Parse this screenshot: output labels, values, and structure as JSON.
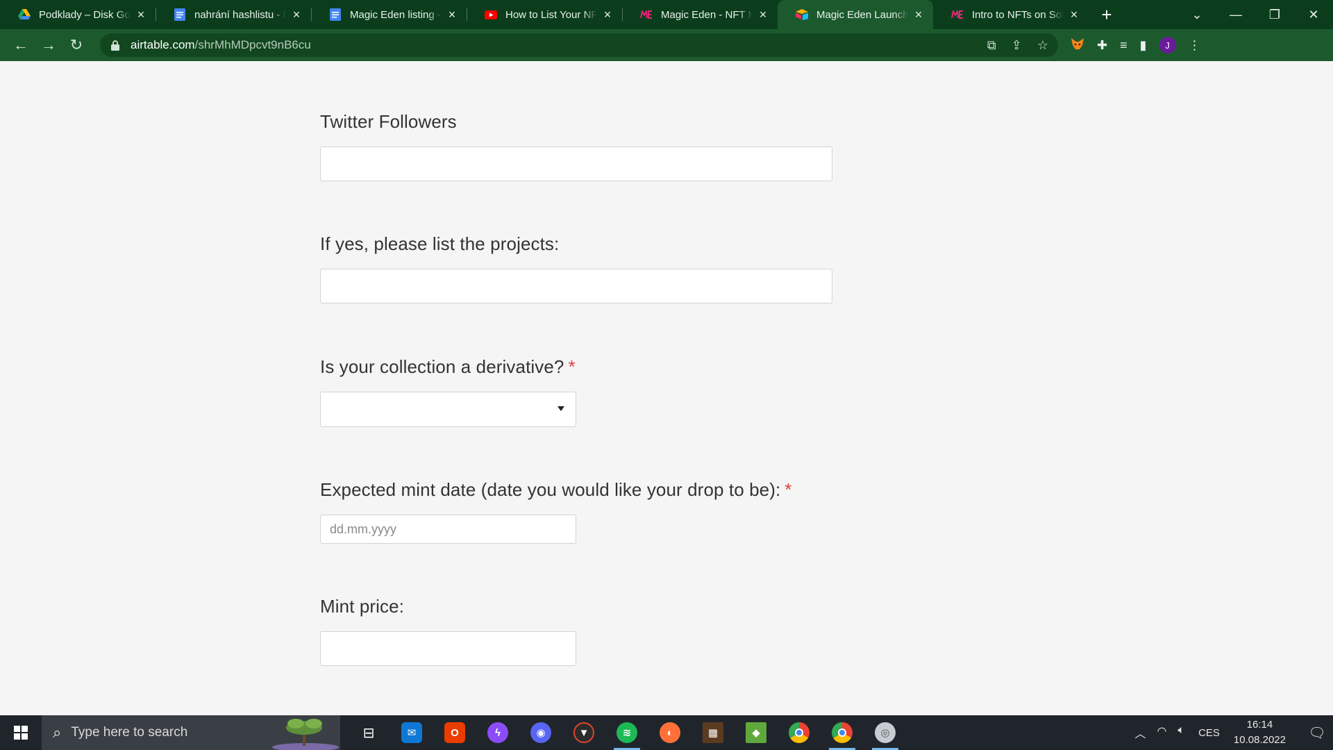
{
  "browser": {
    "tabs": [
      {
        "title": "Podklady – Disk Google",
        "icon": "google-drive-icon",
        "active": false
      },
      {
        "title": "nahrání hashlistu - Dokumenty Google",
        "icon": "google-docs-icon",
        "active": false
      },
      {
        "title": "Magic Eden listing - Dokumenty Google",
        "icon": "google-docs-icon",
        "active": false
      },
      {
        "title": "How to List Your NFT Collection - YouTube",
        "icon": "youtube-icon",
        "active": false
      },
      {
        "title": "Magic Eden - NFT Marketplace",
        "icon": "magic-eden-icon",
        "active": false
      },
      {
        "title": "Magic Eden Launchpad",
        "icon": "airtable-icon",
        "active": true
      },
      {
        "title": "Intro to NFTs on Solana",
        "icon": "magic-eden-icon",
        "active": false
      }
    ],
    "url_host": "airtable.com",
    "url_path": "/shrMhMDpcvt9nB6cu",
    "profile_initial": "J"
  },
  "form": {
    "twitter_followers": {
      "label": "Twitter Followers",
      "value": ""
    },
    "projects": {
      "label": "If yes, please list the projects:",
      "value": ""
    },
    "derivative": {
      "label": "Is your collection a derivative?",
      "required_mark": "*",
      "selected": ""
    },
    "mint_date": {
      "label": "Expected mint date (date you would like your drop to be):",
      "required_mark": "*",
      "placeholder": "dd.mm.yyyy"
    },
    "mint_price": {
      "label": "Mint price:",
      "value": ""
    }
  },
  "taskbar": {
    "search_placeholder": "Type here to search",
    "language": "CES",
    "time": "16:14",
    "date": "10.08.2022"
  },
  "colors": {
    "tab_strip": "#0b3d1c",
    "toolbar": "#1c5a2e",
    "required": "#e0403a",
    "page_bg": "#f5f5f5"
  }
}
